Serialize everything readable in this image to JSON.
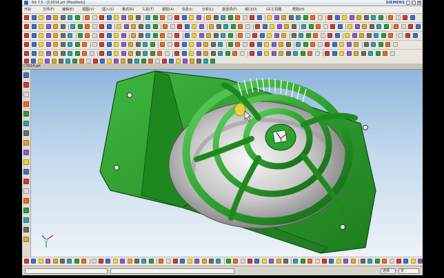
{
  "window": {
    "title": "NX 7.5 - [C3014.prt (Modified)]",
    "brand": "SIEMENS",
    "controls": [
      "_",
      "□",
      "×"
    ]
  },
  "menubar": {
    "items": [
      "开始",
      "文件(F)",
      "编辑(E)",
      "视图(V)",
      "插入(S)",
      "格式(R)",
      "工具(T)",
      "装配(A)",
      "信息(I)",
      "分析(L)",
      "首选项(P)",
      "窗口(O)",
      "GC工具箱",
      "帮助(H)"
    ]
  },
  "partnav": {
    "part_name": "C3014.prt"
  },
  "colors": {
    "model_green": "#2fa12f",
    "model_green_dark": "#146414",
    "model_green_light": "#5fd35f",
    "silver": "#c8c8c8",
    "highlight_yellow": "#e5d436",
    "viewport_top": "#8eb6dc",
    "viewport_bottom": "#eef3f8"
  },
  "model": {
    "description_icon": "fan-shroud-model"
  },
  "status": {
    "fields": [
      "",
      "",
      "选择",
      "无"
    ]
  }
}
